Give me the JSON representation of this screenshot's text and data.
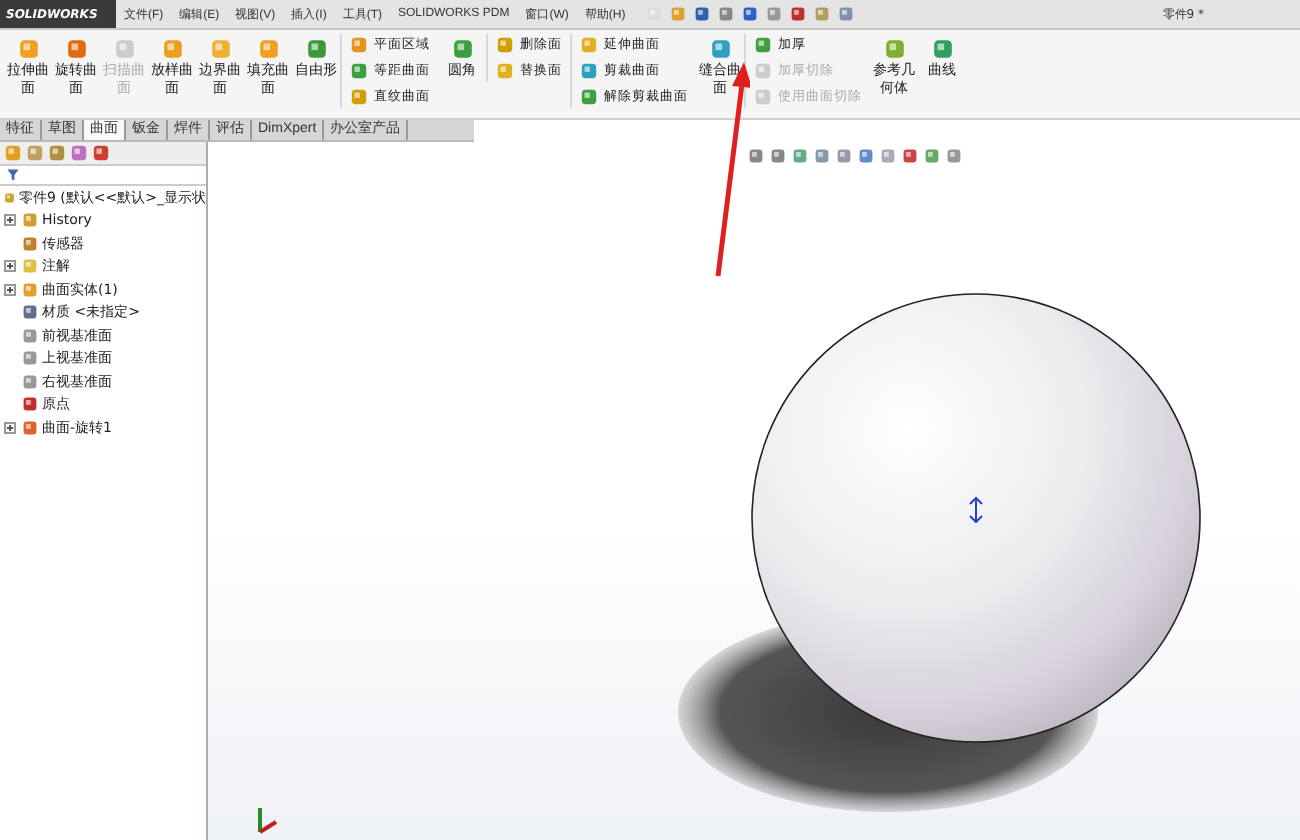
{
  "app": {
    "logo": "SOLIDWORKS",
    "menus": [
      "文件(F)",
      "编辑(E)",
      "视图(V)",
      "插入(I)",
      "工具(T)",
      "SOLIDWORKS PDM",
      "窗口(W)",
      "帮助(H)"
    ],
    "document_title": "零件9 *"
  },
  "ribbon": [
    {
      "kind": "large",
      "label": "拉伸曲面",
      "disabled": false
    },
    {
      "kind": "large",
      "label": "旋转曲面",
      "disabled": false
    },
    {
      "kind": "large",
      "label": "扫描曲面",
      "disabled": true
    },
    {
      "kind": "large",
      "label": "放样曲面",
      "disabled": false
    },
    {
      "kind": "large",
      "label": "边界曲面",
      "disabled": false
    },
    {
      "kind": "large",
      "label": "填充曲面",
      "disabled": false
    },
    {
      "kind": "large",
      "label": "自由形",
      "disabled": false
    },
    {
      "kind": "column",
      "items": [
        {
          "label": "平面区域",
          "disabled": false
        },
        {
          "label": "等距曲面",
          "disabled": false
        },
        {
          "label": "直纹曲面",
          "disabled": false
        }
      ]
    },
    {
      "kind": "large",
      "label": "圆角",
      "disabled": false
    },
    {
      "kind": "column",
      "items": [
        {
          "label": "删除面",
          "disabled": false
        },
        {
          "label": "替换面",
          "disabled": false
        }
      ]
    },
    {
      "kind": "column",
      "items": [
        {
          "label": "延伸曲面",
          "disabled": false
        },
        {
          "label": "剪裁曲面",
          "disabled": false
        },
        {
          "label": "解除剪裁曲面",
          "disabled": false
        }
      ]
    },
    {
      "kind": "large",
      "label": "缝合曲面",
      "disabled": false
    },
    {
      "kind": "column",
      "items": [
        {
          "label": "加厚",
          "disabled": false
        },
        {
          "label": "加厚切除",
          "disabled": true
        },
        {
          "label": "使用曲面切除",
          "disabled": true
        }
      ]
    },
    {
      "kind": "large",
      "label": "参考几何体",
      "disabled": false
    },
    {
      "kind": "large",
      "label": "曲线",
      "disabled": false
    }
  ],
  "tabs": [
    {
      "label": "特征",
      "selected": false
    },
    {
      "label": "草图",
      "selected": false
    },
    {
      "label": "曲面",
      "selected": true
    },
    {
      "label": "钣金",
      "selected": false
    },
    {
      "label": "焊件",
      "selected": false
    },
    {
      "label": "评估",
      "selected": false
    },
    {
      "label": "DimXpert",
      "selected": false
    },
    {
      "label": "办公室产品",
      "selected": false
    }
  ],
  "tree": {
    "label": "零件9 (默认<<默认>_显示状",
    "children": [
      {
        "label": "History",
        "collapsed": true
      },
      {
        "label": "传感器",
        "collapsed": false
      },
      {
        "label": "注解",
        "collapsed": true
      },
      {
        "label": "曲面实体(1)",
        "collapsed": true
      },
      {
        "label": "材质 <未指定>",
        "collapsed": false
      },
      {
        "label": "前视基准面",
        "collapsed": false
      },
      {
        "label": "上视基准面",
        "collapsed": false
      },
      {
        "label": "右视基准面",
        "collapsed": false
      },
      {
        "label": "原点",
        "collapsed": false
      },
      {
        "label": "曲面-旋转1",
        "collapsed": true
      }
    ]
  }
}
